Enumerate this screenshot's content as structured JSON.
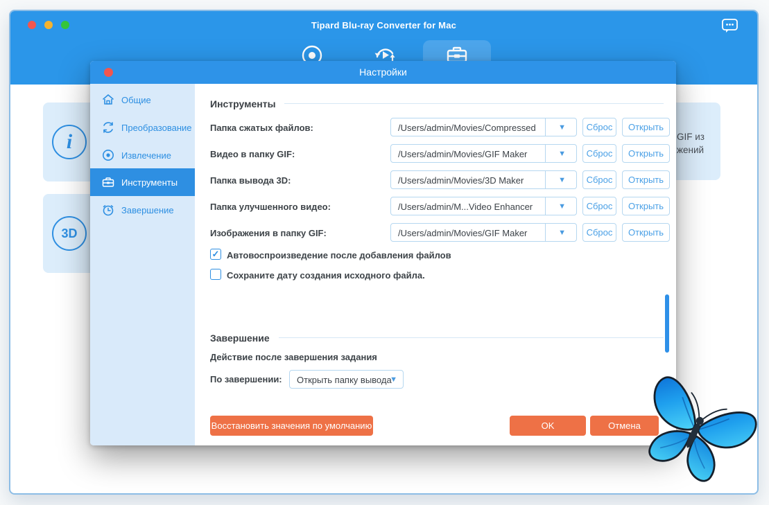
{
  "window": {
    "title": "Tipard Blu-ray Converter for Mac",
    "toolbar": {
      "icons": [
        "disc-icon",
        "convert-icon",
        "toolbox-icon"
      ],
      "active_icon": "toolbox-icon"
    },
    "chat_icon": "message-bubble-icon"
  },
  "background_cards": {
    "info_glyph": "i",
    "threed_glyph": "3D",
    "gif_card_lines": [
      "GIF из",
      "жений"
    ]
  },
  "dialog": {
    "title": "Настройки",
    "sidebar": {
      "active_index": 3,
      "items": [
        {
          "label": "Общие",
          "icon": "home-icon"
        },
        {
          "label": "Преобразование",
          "icon": "refresh-icon"
        },
        {
          "label": "Извлечение",
          "icon": "disc-dot-icon"
        },
        {
          "label": "Инструменты",
          "icon": "toolbox-icon"
        },
        {
          "label": "Завершение",
          "icon": "clock-icon"
        }
      ]
    },
    "tools": {
      "heading": "Инструменты",
      "reset_label": "Сброс",
      "open_label": "Открыть",
      "rows": [
        {
          "label": "Папка сжатых файлов:",
          "value": "/Users/admin/Movies/Compressed"
        },
        {
          "label": "Видео в папку GIF:",
          "value": "/Users/admin/Movies/GIF Maker"
        },
        {
          "label": "Папка вывода 3D:",
          "value": "/Users/admin/Movies/3D Maker"
        },
        {
          "label": "Папка улучшенного видео:",
          "value": "/Users/admin/M...Video Enhancer"
        },
        {
          "label": "Изображения в папку GIF:",
          "value": "/Users/admin/Movies/GIF Maker"
        }
      ],
      "checkboxes": [
        {
          "label": "Автовоспроизведение после добавления файлов",
          "checked": true,
          "mark": "✓"
        },
        {
          "label": "Сохраните дату создания исходного файла.",
          "checked": false,
          "mark": ""
        }
      ]
    },
    "finish": {
      "heading": "Завершение",
      "subheading": "Действие после завершения задания",
      "on_finish_label": "По завершении:",
      "on_finish_value": "Открыть папку вывода"
    },
    "footer": {
      "restore_label": "Восстановить значения по умолчанию",
      "ok_label": "OK",
      "cancel_label": "Отмена"
    }
  },
  "icons": {
    "dropdown_arrow": "▼",
    "chat_dots": "···"
  },
  "colors": {
    "header_blue": "#2b96e9",
    "accent_blue": "#2e8fe2",
    "sidebar_bg": "#d9eafa",
    "card_bg": "#dcedfb",
    "light_border": "#b5d7f0",
    "button_orange": "#ee7146",
    "scrollbar_blue": "#2e90e8",
    "close_red": "#f3564e"
  }
}
